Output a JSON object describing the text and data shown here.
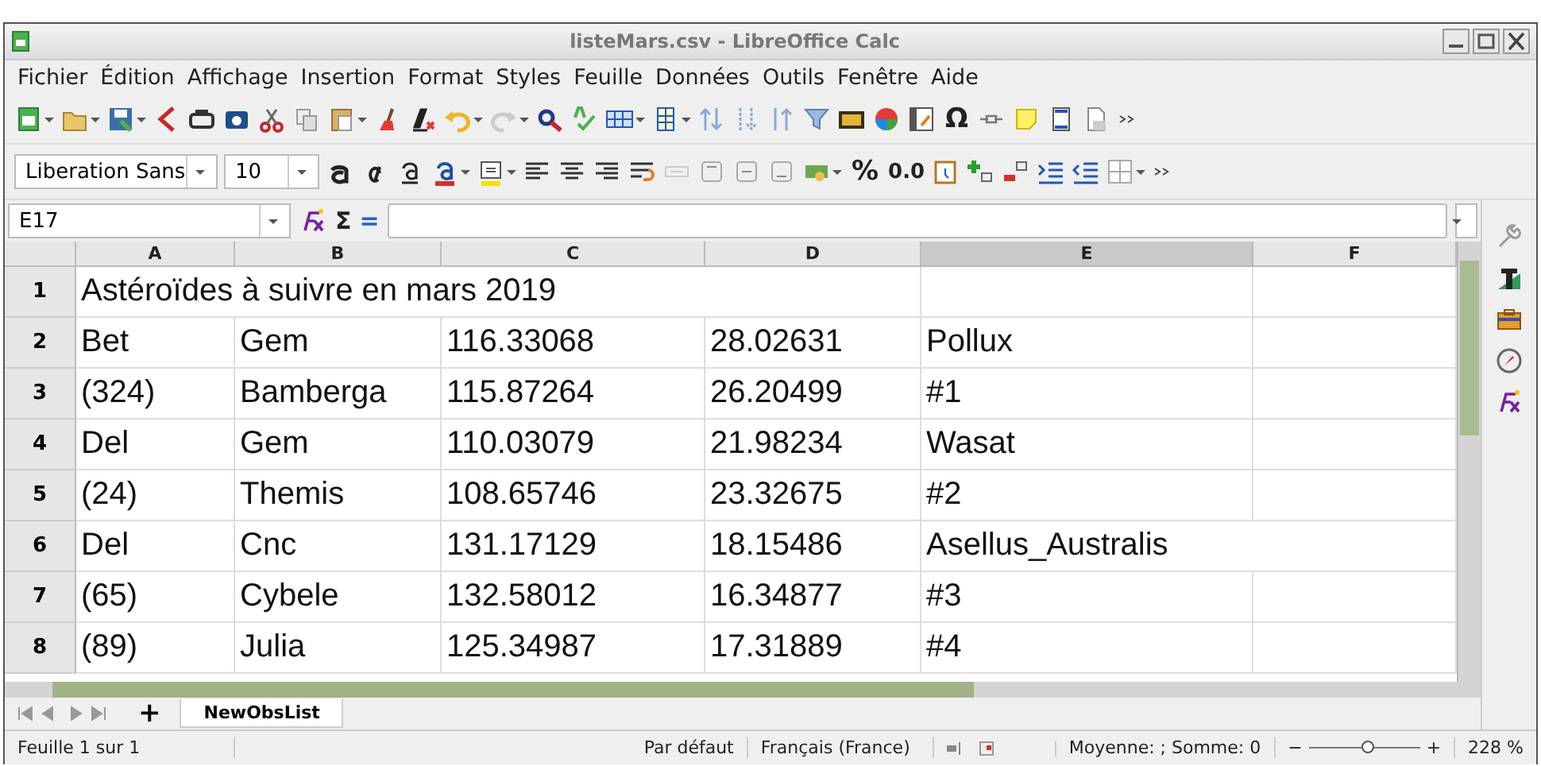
{
  "window": {
    "title": "listeMars.csv - LibreOffice Calc"
  },
  "menu": [
    "Fichier",
    "Édition",
    "Affichage",
    "Insertion",
    "Format",
    "Styles",
    "Feuille",
    "Données",
    "Outils",
    "Fenêtre",
    "Aide"
  ],
  "toolbar": {
    "special_character": "Ω"
  },
  "format_bar": {
    "font_name": "Liberation Sans",
    "font_size": "10",
    "percent": "%",
    "number": "0.0"
  },
  "formula_bar": {
    "name_box": "E17",
    "sum": "Σ",
    "equals": "="
  },
  "columns": [
    {
      "label": "A",
      "selected": false
    },
    {
      "label": "B",
      "selected": false
    },
    {
      "label": "C",
      "selected": false
    },
    {
      "label": "D",
      "selected": false
    },
    {
      "label": "E",
      "selected": true
    },
    {
      "label": "F",
      "selected": false
    }
  ],
  "rows": [
    {
      "header": "1",
      "cells": [
        "Astéroïdes à suivre en mars 2019"
      ]
    },
    {
      "header": "2",
      "cells": [
        "Bet",
        "Gem",
        "116.33068",
        "28.02631",
        "Pollux"
      ]
    },
    {
      "header": "3",
      "cells": [
        "(324)",
        "Bamberga",
        "115.87264",
        "26.20499",
        "#1"
      ]
    },
    {
      "header": "4",
      "cells": [
        "Del",
        "Gem",
        "110.03079",
        "21.98234",
        "Wasat"
      ]
    },
    {
      "header": "5",
      "cells": [
        "(24)",
        "Themis",
        "108.65746",
        "23.32675",
        "#2"
      ]
    },
    {
      "header": "6",
      "cells": [
        "Del",
        "Cnc",
        "131.17129",
        "18.15486",
        "Asellus_Australis"
      ]
    },
    {
      "header": "7",
      "cells": [
        "(65)",
        "Cybele",
        "132.58012",
        "16.34877",
        "#3"
      ]
    },
    {
      "header": "8",
      "cells": [
        "(89)",
        "Julia",
        "125.34987",
        "17.31889",
        "#4"
      ]
    }
  ],
  "sheet_tabs": {
    "add": "+",
    "tabs": [
      {
        "label": "NewObsList",
        "selected": true
      }
    ]
  },
  "status_bar": {
    "sheet": "Feuille 1 sur 1",
    "page_style": "Par défaut",
    "language": "Français (France)",
    "summary": "Moyenne: ; Somme: 0",
    "zoom_out": "−",
    "zoom_in": "+",
    "zoom_slider": {
      "level": 0.55
    },
    "zoom": "228 %"
  }
}
